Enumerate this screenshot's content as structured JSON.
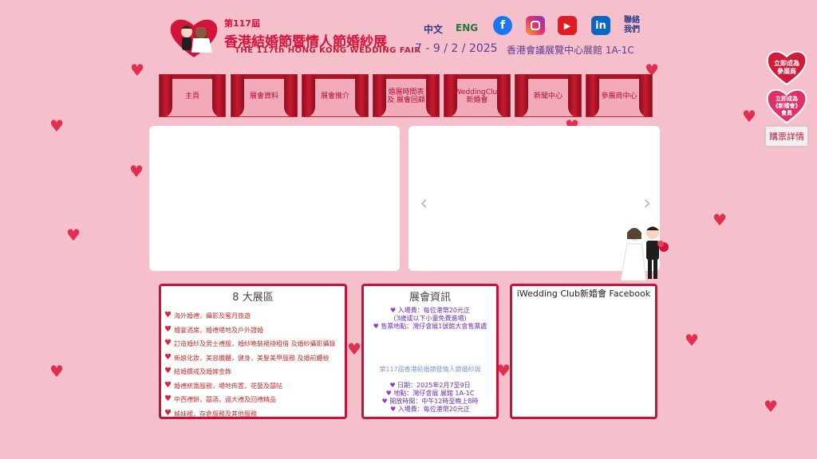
{
  "header": {
    "logo_edition": "第117屆",
    "logo_title": "香港結婚節暨情人節婚紗展",
    "logo_subtitle_en": "THE 117th HONG KONG WEDDING FAIR",
    "lang_zh": "中文",
    "lang_en": "ENG",
    "contact": "聯絡我們",
    "date": "7 - 9 / 2 / 2025",
    "venue": "香港會議展覽中心展館 1A-1C",
    "social": [
      "facebook-icon",
      "instagram-icon",
      "youtube-icon",
      "linkedin-icon"
    ]
  },
  "nav": [
    "主頁",
    "展會資料",
    "展會推介",
    "婚展時間表 及 展會回顧",
    "iWeddingClub 新婚會",
    "新聞中心",
    "參展商中心"
  ],
  "side": {
    "exhibitor": "立即成為 參展商",
    "member": "立即成為 《新婚會》 會員",
    "tickets": "購票詳情"
  },
  "zones": {
    "title": "8 大展區",
    "items": [
      "海外婚禮，攝影及蜜月旅遊",
      "婚宴酒席，婚禮場地及戶外證婚",
      "訂造婚紗及男士禮服，婚紗晚裝裙褂租借 及婚紗攝影攝錄",
      "新娘化妝，美容纖體，健身，美髮美甲服務 及婚前體檢",
      "結婚鑽戒及婚嫁金飾",
      "婚禮統籌服務，場地佈置，花藝及囍帖",
      "中西禮餅，囍酒，過大禮及回禮精品",
      "姊妹裙，存倉服務及其他服務"
    ]
  },
  "info": {
    "title": "展會資訊",
    "top": [
      "入場費：每位港幣20元正",
      "(3歲或以下小童免費進場)",
      "售票地點：灣仔會展1號館大會售票處"
    ],
    "subtitle": "第117屆香港結婚節暨情人節婚紗展",
    "bottom": [
      "日期：2025年2月7至9日",
      "地點：灣仔會展 展館 1A-1C",
      "開放時間：中午12時至晚上8時",
      "入場費：每位港幣20元正"
    ]
  },
  "facebook": {
    "title": "iWedding Club新婚會 Facebook"
  },
  "colors": {
    "background": "#f6bfcc",
    "brand_red": "#d2143a",
    "accent_purple": "#5a3b8f"
  }
}
